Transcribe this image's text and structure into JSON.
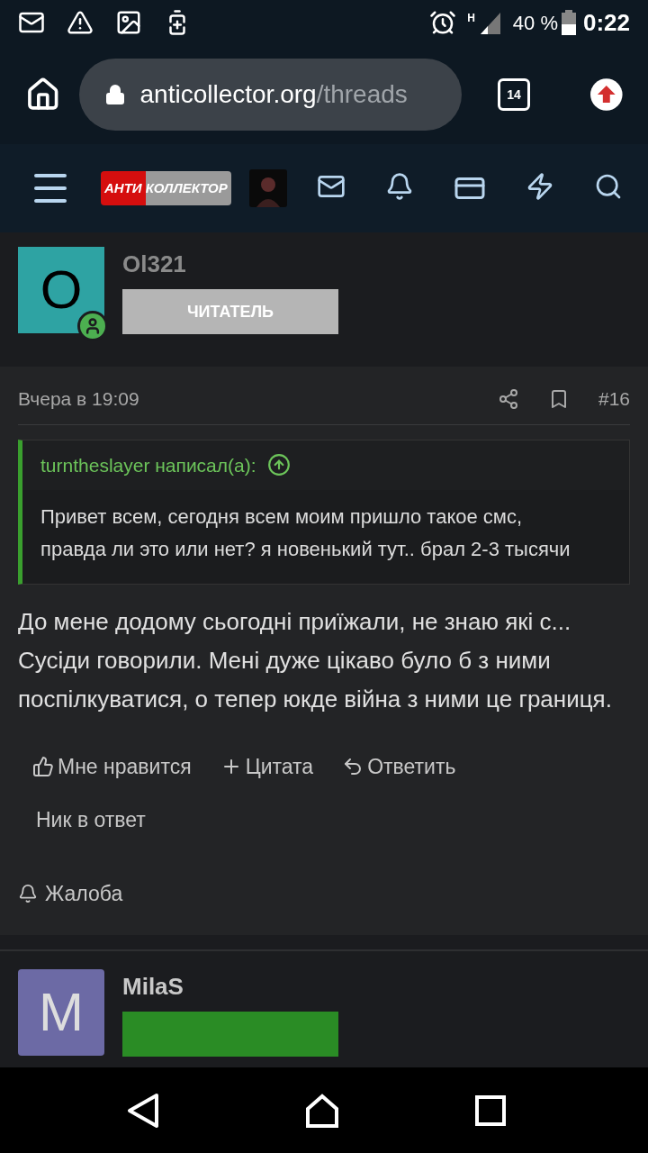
{
  "status_bar": {
    "battery": "40 %",
    "time": "0:22",
    "network": "H"
  },
  "browser": {
    "url_host": "anticollector.org",
    "url_path": "/threads",
    "tab_count": "14"
  },
  "site_header": {
    "logo_left": "АНТИ",
    "logo_right": "КОЛЛЕКТОР"
  },
  "post": {
    "author": {
      "initial": "O",
      "name": "Ol321",
      "role": "ЧИТАТЕЛЬ",
      "online": true
    },
    "time": "Вчера в 19:09",
    "number": "#16",
    "quote": {
      "author": "turntheslayer написал(а):",
      "text": "Привет всем, сегодня всем моим пришло такое смс, правда ли это или нет? я новенький тут.. брал 2-3 тысячи"
    },
    "body": "До мене додому сьогодні приїжали, не знаю які с... Сусіди говорили. Мені дуже цікаво було б з ними поспілкуватися, о тепер юкде війна з ними це границя.",
    "actions": [
      {
        "kind": "like",
        "label": "Мне нравится"
      },
      {
        "kind": "quote",
        "label": "Цитата"
      },
      {
        "kind": "reply",
        "label": "Ответить"
      },
      {
        "kind": "mention",
        "label": "Ник в ответ"
      }
    ],
    "report": "Жалоба"
  },
  "next_post": {
    "author": {
      "initial": "M",
      "name": "MilaS"
    }
  }
}
